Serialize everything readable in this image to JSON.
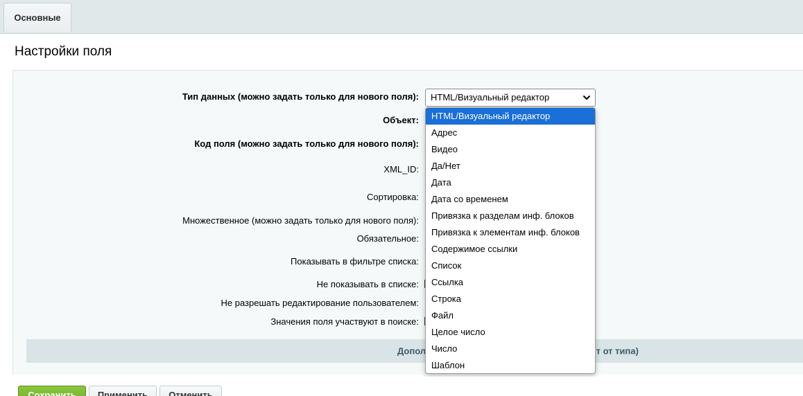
{
  "tabs": [
    {
      "label": "Основные"
    }
  ],
  "section": {
    "title": "Настройки поля"
  },
  "form": {
    "fields": [
      {
        "label": "Тип данных (можно задать только для нового поля):",
        "bold": true
      },
      {
        "label": "Объект:",
        "bold": true
      },
      {
        "label": "Код поля (можно задать только для нового поля):",
        "bold": true
      },
      {
        "label": "XML_ID:",
        "bold": false
      },
      {
        "label": "Сортировка:",
        "bold": false
      },
      {
        "label": "Множественное (можно задать только для нового поля):",
        "bold": false
      },
      {
        "label": "Обязательное:",
        "bold": false
      },
      {
        "label": "Показывать в фильтре списка:",
        "bold": false
      },
      {
        "label": "Не показывать в списке:",
        "bold": false
      },
      {
        "label": "Не разрешать редактирование пользователем:",
        "bold": false
      },
      {
        "label": "Значения поля участвуют в поиске:",
        "bold": false
      }
    ],
    "data_type_select": {
      "value": "HTML/Визуальный редактор",
      "options": [
        "HTML/Визуальный редактор",
        "Адрес",
        "Видео",
        "Да/Нет",
        "Дата",
        "Дата со временем",
        "Привязка к разделам инф. блоков",
        "Привязка к элементам инф. блоков",
        "Содержимое ссылки",
        "Список",
        "Ссылка",
        "Строка",
        "Файл",
        "Целое число",
        "Число",
        "Шаблон"
      ]
    }
  },
  "additional": {
    "left_text": "Допол",
    "right_text": "ят от типа)"
  },
  "buttons": {
    "save": "Сохранить",
    "apply": "Применить",
    "cancel": "Отменить"
  },
  "colors": {
    "accent_selected": "#1a6fd8",
    "save_button": "#7ab832",
    "form_bg": "#f5f9f9",
    "tabbar_bg": "#e0e8ea"
  }
}
